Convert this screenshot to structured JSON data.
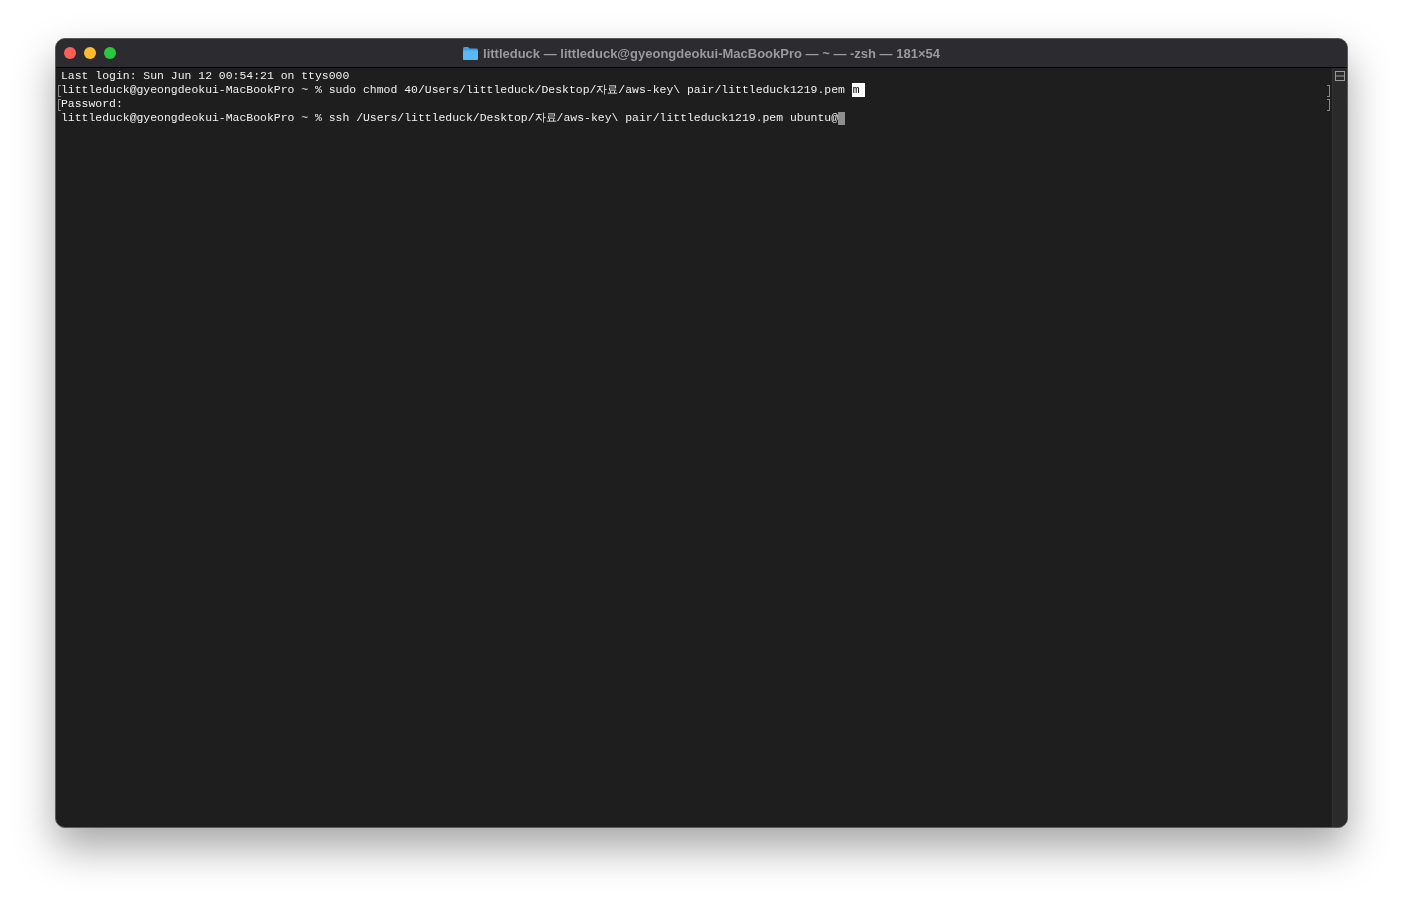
{
  "window": {
    "title": "littleduck — littleduck@gyeongdeokui-MacBookPro — ~ — -zsh — 181×54"
  },
  "terminal": {
    "lines": [
      {
        "text": "Last login: Sun Jun 12 00:54:21 on ttys000",
        "marked": false
      },
      {
        "text": "littleduck@gyeongdeokui-MacBookPro ~ % sudo chmod 40/Users/littleduck/Desktop/자료/aws-key\\ pair/littleduck1219.pem ",
        "selection": "m",
        "marked": true
      },
      {
        "text": "Password:",
        "marked": true
      },
      {
        "text": "littleduck@gyeongdeokui-MacBookPro ~ % ssh /Users/littleduck/Desktop/자료/aws-key\\ pair/littleduck1219.pem ubuntu@",
        "cursor": true,
        "marked": false
      }
    ]
  }
}
